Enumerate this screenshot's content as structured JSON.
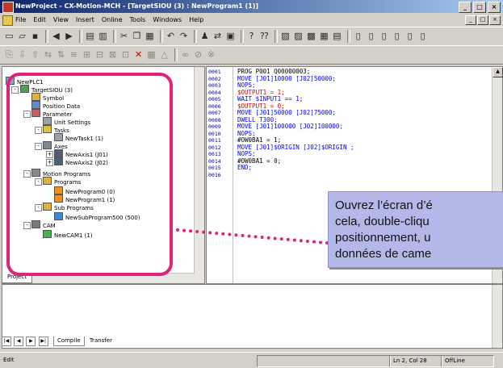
{
  "window": {
    "title": "NewProject - CX-Motion-MCH - [TargetSIOU (3) : NewProgram1 (1)]",
    "controls": [
      "_",
      "□",
      "×"
    ]
  },
  "menu": {
    "items": [
      "File",
      "Edit",
      "View",
      "Insert",
      "Online",
      "Tools",
      "Windows",
      "Help"
    ]
  },
  "tree": {
    "root": "NewPLC1",
    "target": "TargetSIOU (3)",
    "symbol": "Symbol",
    "position_data": "Position Data",
    "parameter": "Parameter",
    "unit_settings": "Unit Settings",
    "tasks": "Tasks",
    "newtask": "NewTask1 (1)",
    "axes": "Axes",
    "axis1": "NewAxis1 (J01)",
    "axis2": "NewAxis2 (J02)",
    "motion_programs": "Motion Programs",
    "programs": "Programs",
    "prog0": "NewProgram0 (0)",
    "prog1": "NewProgram1 (1)",
    "sub_programs": "Sub Programs",
    "subprog": "NewSubProgram500 (500)",
    "cam": "CAM",
    "newcam": "NewCAM1 (1)"
  },
  "project_tab": "Project",
  "code": {
    "lines": [
      {
        "n": "0001",
        "t": "PROG P001 Q00000003;",
        "c": "black"
      },
      {
        "n": "0002",
        "t": "MOVE [J01]10000 [J02]50000;",
        "c": "blue"
      },
      {
        "n": "0003",
        "t": "NOPS;",
        "c": "blue"
      },
      {
        "n": "0004",
        "t": "$OUTPUT1 = 1;",
        "c": "red"
      },
      {
        "n": "0005",
        "t": "WAIT $INPUT1 == 1;",
        "c": "blue"
      },
      {
        "n": "0006",
        "t": "$OUTPUT1 = 0;",
        "c": "red"
      },
      {
        "n": "0007",
        "t": "MOVE [J01]50000 [J02]75000;",
        "c": "blue"
      },
      {
        "n": "0008",
        "t": "DWELL T300;",
        "c": "blue"
      },
      {
        "n": "0009",
        "t": "MOVE [J01]100000 [J02]100000;",
        "c": "blue"
      },
      {
        "n": "0010",
        "t": "NOPS;",
        "c": "blue"
      },
      {
        "n": "0011",
        "t": "#OW0BA1 = 1;",
        "c": "black"
      },
      {
        "n": "0012",
        "t": "MOVE [J01]$ORIGIN [J02]$ORIGIN ;",
        "c": "blue"
      },
      {
        "n": "0013",
        "t": "NOPS;",
        "c": "blue"
      },
      {
        "n": "0014",
        "t": "#OW0BA1 = 0;",
        "c": "black"
      },
      {
        "n": "0015",
        "t": "END;",
        "c": "blue"
      },
      {
        "n": "0016",
        "t": "",
        "c": "black"
      }
    ]
  },
  "output_tabs": [
    "Compile",
    "Transfer"
  ],
  "status": {
    "mode": "Edit",
    "position": "Ln 2, Col 28",
    "connection": "OffLine"
  },
  "callout": {
    "line1": "Ouvrez l’écran d’é",
    "line2": "cela, double-cliqu",
    "line3": "positionnement, u",
    "line4": "données de came"
  },
  "colors": {
    "highlight": "#e0237a",
    "callout_bg": "#b4b8e8",
    "code_blue": "#0000ff",
    "code_red": "#d00000"
  }
}
